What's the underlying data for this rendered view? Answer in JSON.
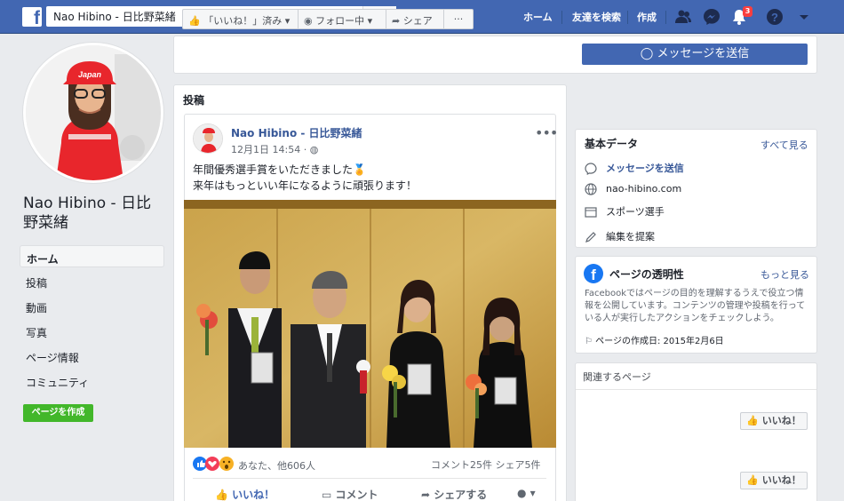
{
  "topbar": {
    "logo": "f",
    "search_value": "Nao Hibino - 日比野菜緒",
    "nav": [
      "ホーム",
      "友達を検索",
      "作成"
    ],
    "notification_count": "3",
    "icons": [
      "friends-icon",
      "messenger-icon",
      "bell-icon",
      "help-icon",
      "caret-down-icon"
    ]
  },
  "sidebar": {
    "page_name": "Nao Hibino - 日比野菜緒",
    "avatar_text": "Japan",
    "items": [
      {
        "label": "ホーム",
        "active": true
      },
      {
        "label": "投稿"
      },
      {
        "label": "動画"
      },
      {
        "label": "写真"
      },
      {
        "label": "ページ情報"
      },
      {
        "label": "コミュニティ"
      }
    ],
    "create_page_label": "ページを作成"
  },
  "actionbar": {
    "like_label": "「いいね！」済み",
    "follow_label": "フォロー中",
    "share_label": "シェア",
    "more_label": "···",
    "message_label": "メッセージを送信"
  },
  "posts": {
    "heading": "投稿",
    "author": "Nao Hibino - 日比野菜緒",
    "time": "12月1日 14:54 · ",
    "text_line1": "年間優秀選手賞をいただきました🏅",
    "text_line2": "来年はもっといい年になるように頑張ります！",
    "reaction_names": "あなた、他606人",
    "comment_count": "コメント25件",
    "share_count": "シェア5件",
    "actions": {
      "like": "いいね！",
      "comment": "コメント",
      "share": "シェアする"
    }
  },
  "about": {
    "title": "基本データ",
    "see_all": "すべて見る",
    "rows": [
      {
        "icon": "messenger-icon",
        "label": "メッセージを送信",
        "link": true
      },
      {
        "icon": "globe-icon",
        "label": "nao-hibino.com",
        "link": false
      },
      {
        "icon": "category-icon",
        "label": "スポーツ選手",
        "link": false
      },
      {
        "icon": "pencil-icon",
        "label": "編集を提案",
        "link": false
      }
    ]
  },
  "transparency": {
    "title": "ページの透明性",
    "more": "もっと見る",
    "description": "Facebookではページの目的を理解するうえで役立つ情報を公開しています。コンテンツの管理や投稿を行っている人が実行したアクションをチェックしよう。",
    "created": "ページの作成日: 2015年2月6日"
  },
  "related": {
    "title": "関連するページ",
    "like_label": "いいね！"
  },
  "colors": {
    "brand": "#4267b2",
    "link": "#385898",
    "green": "#42b72a",
    "notification": "#fa3e3e"
  }
}
